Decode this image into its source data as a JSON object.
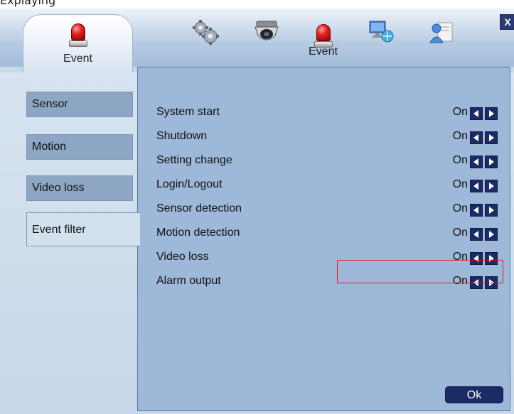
{
  "top_strip_text": "Explaying",
  "toolbar": {
    "active_tab_label": "Event",
    "icons": [
      "siren-icon",
      "gears-icon",
      "camera-icon",
      "siren-icon",
      "network-icon",
      "user-icon"
    ],
    "event_icon_label": "Event",
    "close_label": "X"
  },
  "sidebar": {
    "items": [
      {
        "label": "Sensor"
      },
      {
        "label": "Motion"
      },
      {
        "label": "Video loss"
      },
      {
        "label": "Event filter",
        "selected": true
      }
    ]
  },
  "event_filter": {
    "rows": [
      {
        "label": "System start",
        "value": "On"
      },
      {
        "label": "Shutdown",
        "value": "On"
      },
      {
        "label": "Setting change",
        "value": "On"
      },
      {
        "label": "Login/Logout",
        "value": "On"
      },
      {
        "label": "Sensor detection",
        "value": "On"
      },
      {
        "label": "Motion detection",
        "value": "On"
      },
      {
        "label": "Video loss",
        "value": "On"
      },
      {
        "label": "Alarm output",
        "value": "On",
        "highlighted": true
      }
    ]
  },
  "ok_label": "Ok",
  "colors": {
    "accent": "#1a2b66",
    "panel": "#9db8d8",
    "highlight": "#e02020"
  }
}
